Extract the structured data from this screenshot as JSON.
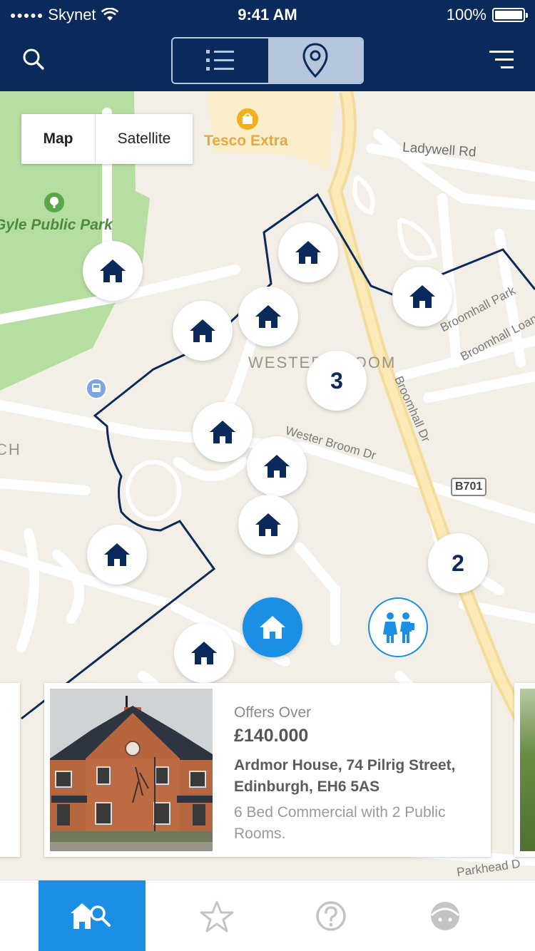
{
  "status_bar": {
    "carrier": "Skynet",
    "time": "9:41 AM",
    "battery": "100%"
  },
  "header": {
    "view_toggle": {
      "selected": "map"
    }
  },
  "map": {
    "map_type": {
      "map_label": "Map",
      "satellite_label": "Satellite",
      "selected": "Map"
    },
    "labels": {
      "park": "Gyle Public Park",
      "store": "Tesco Extra",
      "road_ladywell": "Ladywell Rd",
      "area": "WESTER BROOM",
      "road_broomhall_park": "Broomhall Park",
      "road_broomhall_loan": "Broomhall Loan",
      "road_broomhall_dr": "Broomhall Dr",
      "road_wester_broom_dr": "Wester Broom Dr",
      "road_b701": "B701",
      "road_bottom": "Parkhead D",
      "area_left": "CH"
    },
    "clusters": [
      {
        "count": "3"
      },
      {
        "count": "2"
      }
    ]
  },
  "listing": {
    "offer_type": "Offers Over",
    "price": "£140.000",
    "address_line1": "Ardmor House, 74 Pilrig Street,",
    "address_line2": "Edinburgh, EH6 5AS",
    "description_line1": "6 Bed Commercial with 2 Public",
    "description_line2": "Rooms."
  },
  "tabs": [
    {
      "icon": "home-search-icon",
      "active": true
    },
    {
      "icon": "star-icon",
      "active": false
    },
    {
      "icon": "help-icon",
      "active": false
    },
    {
      "icon": "profile-icon",
      "active": false
    }
  ],
  "colors": {
    "navy": "#0b2a5c",
    "accent_blue": "#1a8fe3",
    "map_bg": "#f4efe6",
    "park_green": "#b5dea0"
  }
}
